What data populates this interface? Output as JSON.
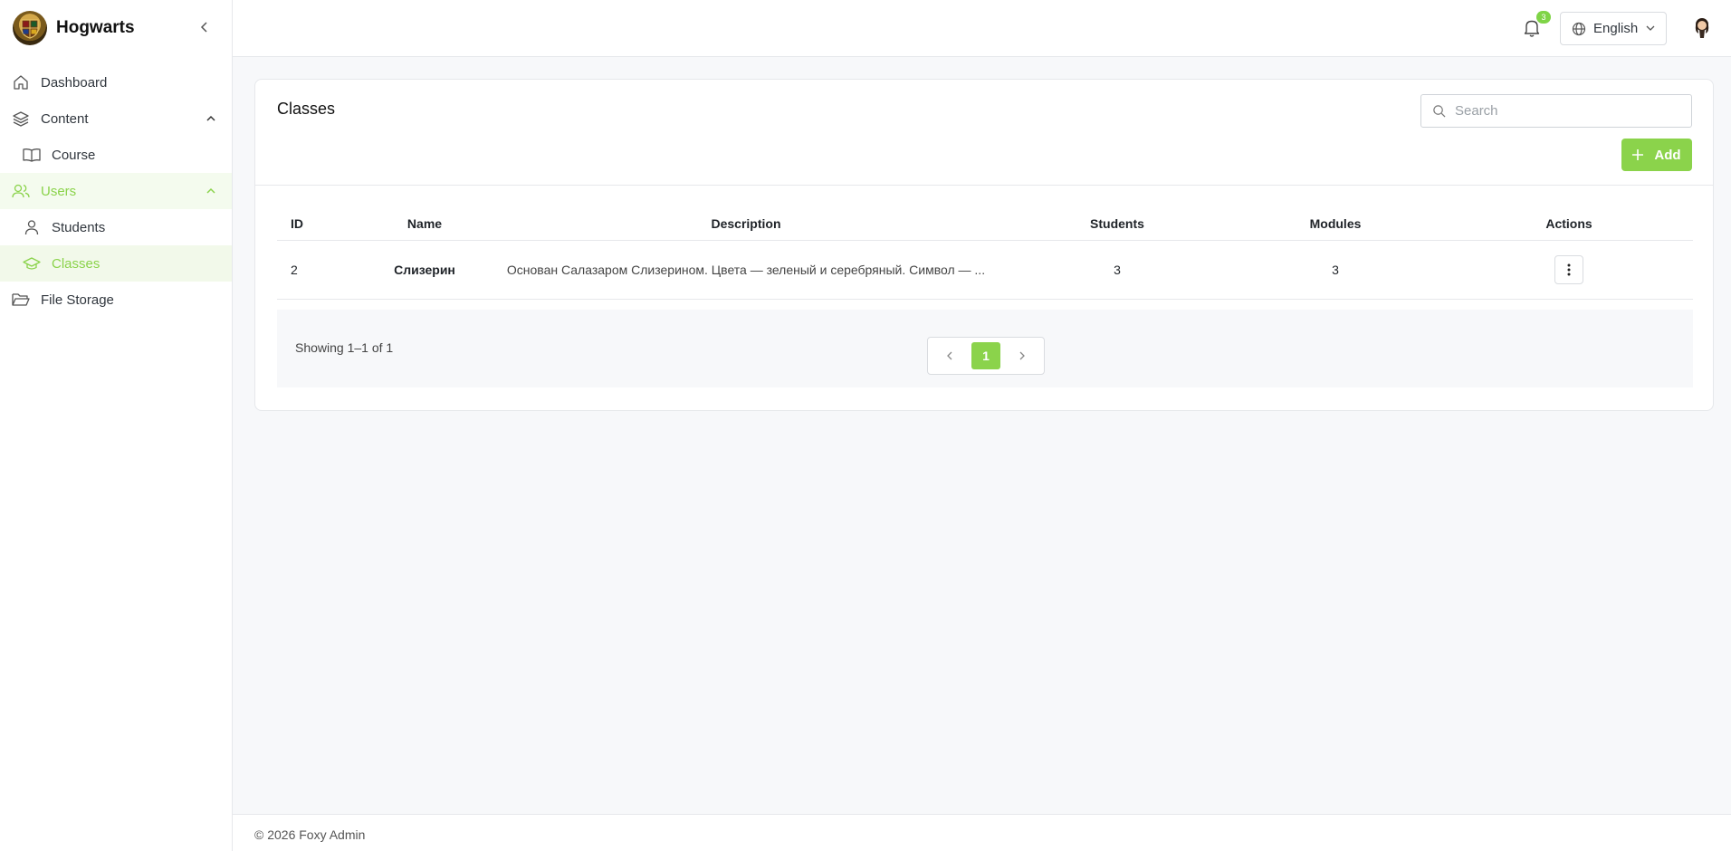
{
  "brand": {
    "name": "Hogwarts"
  },
  "sidebar": {
    "items": [
      {
        "label": "Dashboard",
        "icon": "home-icon"
      },
      {
        "label": "Content",
        "icon": "layers-icon"
      },
      {
        "label": "Course",
        "icon": "book-icon"
      },
      {
        "label": "Users",
        "icon": "users-icon"
      },
      {
        "label": "Students",
        "icon": "user-icon"
      },
      {
        "label": "Classes",
        "icon": "graduation-cap-icon"
      },
      {
        "label": "File Storage",
        "icon": "folder-icon"
      }
    ]
  },
  "header": {
    "notifications_count": "3",
    "language": "English"
  },
  "main": {
    "title": "Classes",
    "search_placeholder": "Search",
    "add_label": "Add",
    "columns": [
      "ID",
      "Name",
      "Description",
      "Students",
      "Modules",
      "Actions"
    ],
    "rows": [
      {
        "id": "2",
        "name": "Слизерин",
        "description": "Основан Салазаром Слизерином. Цвета — зеленый и серебряный. Символ — ...",
        "students": "3",
        "modules": "3"
      }
    ],
    "showing": "Showing 1–1 of 1",
    "current_page": "1"
  },
  "footer": {
    "text": "© 2026 Foxy Admin"
  },
  "colors": {
    "accent": "#8bd34b",
    "background": "#f7f8fa"
  }
}
